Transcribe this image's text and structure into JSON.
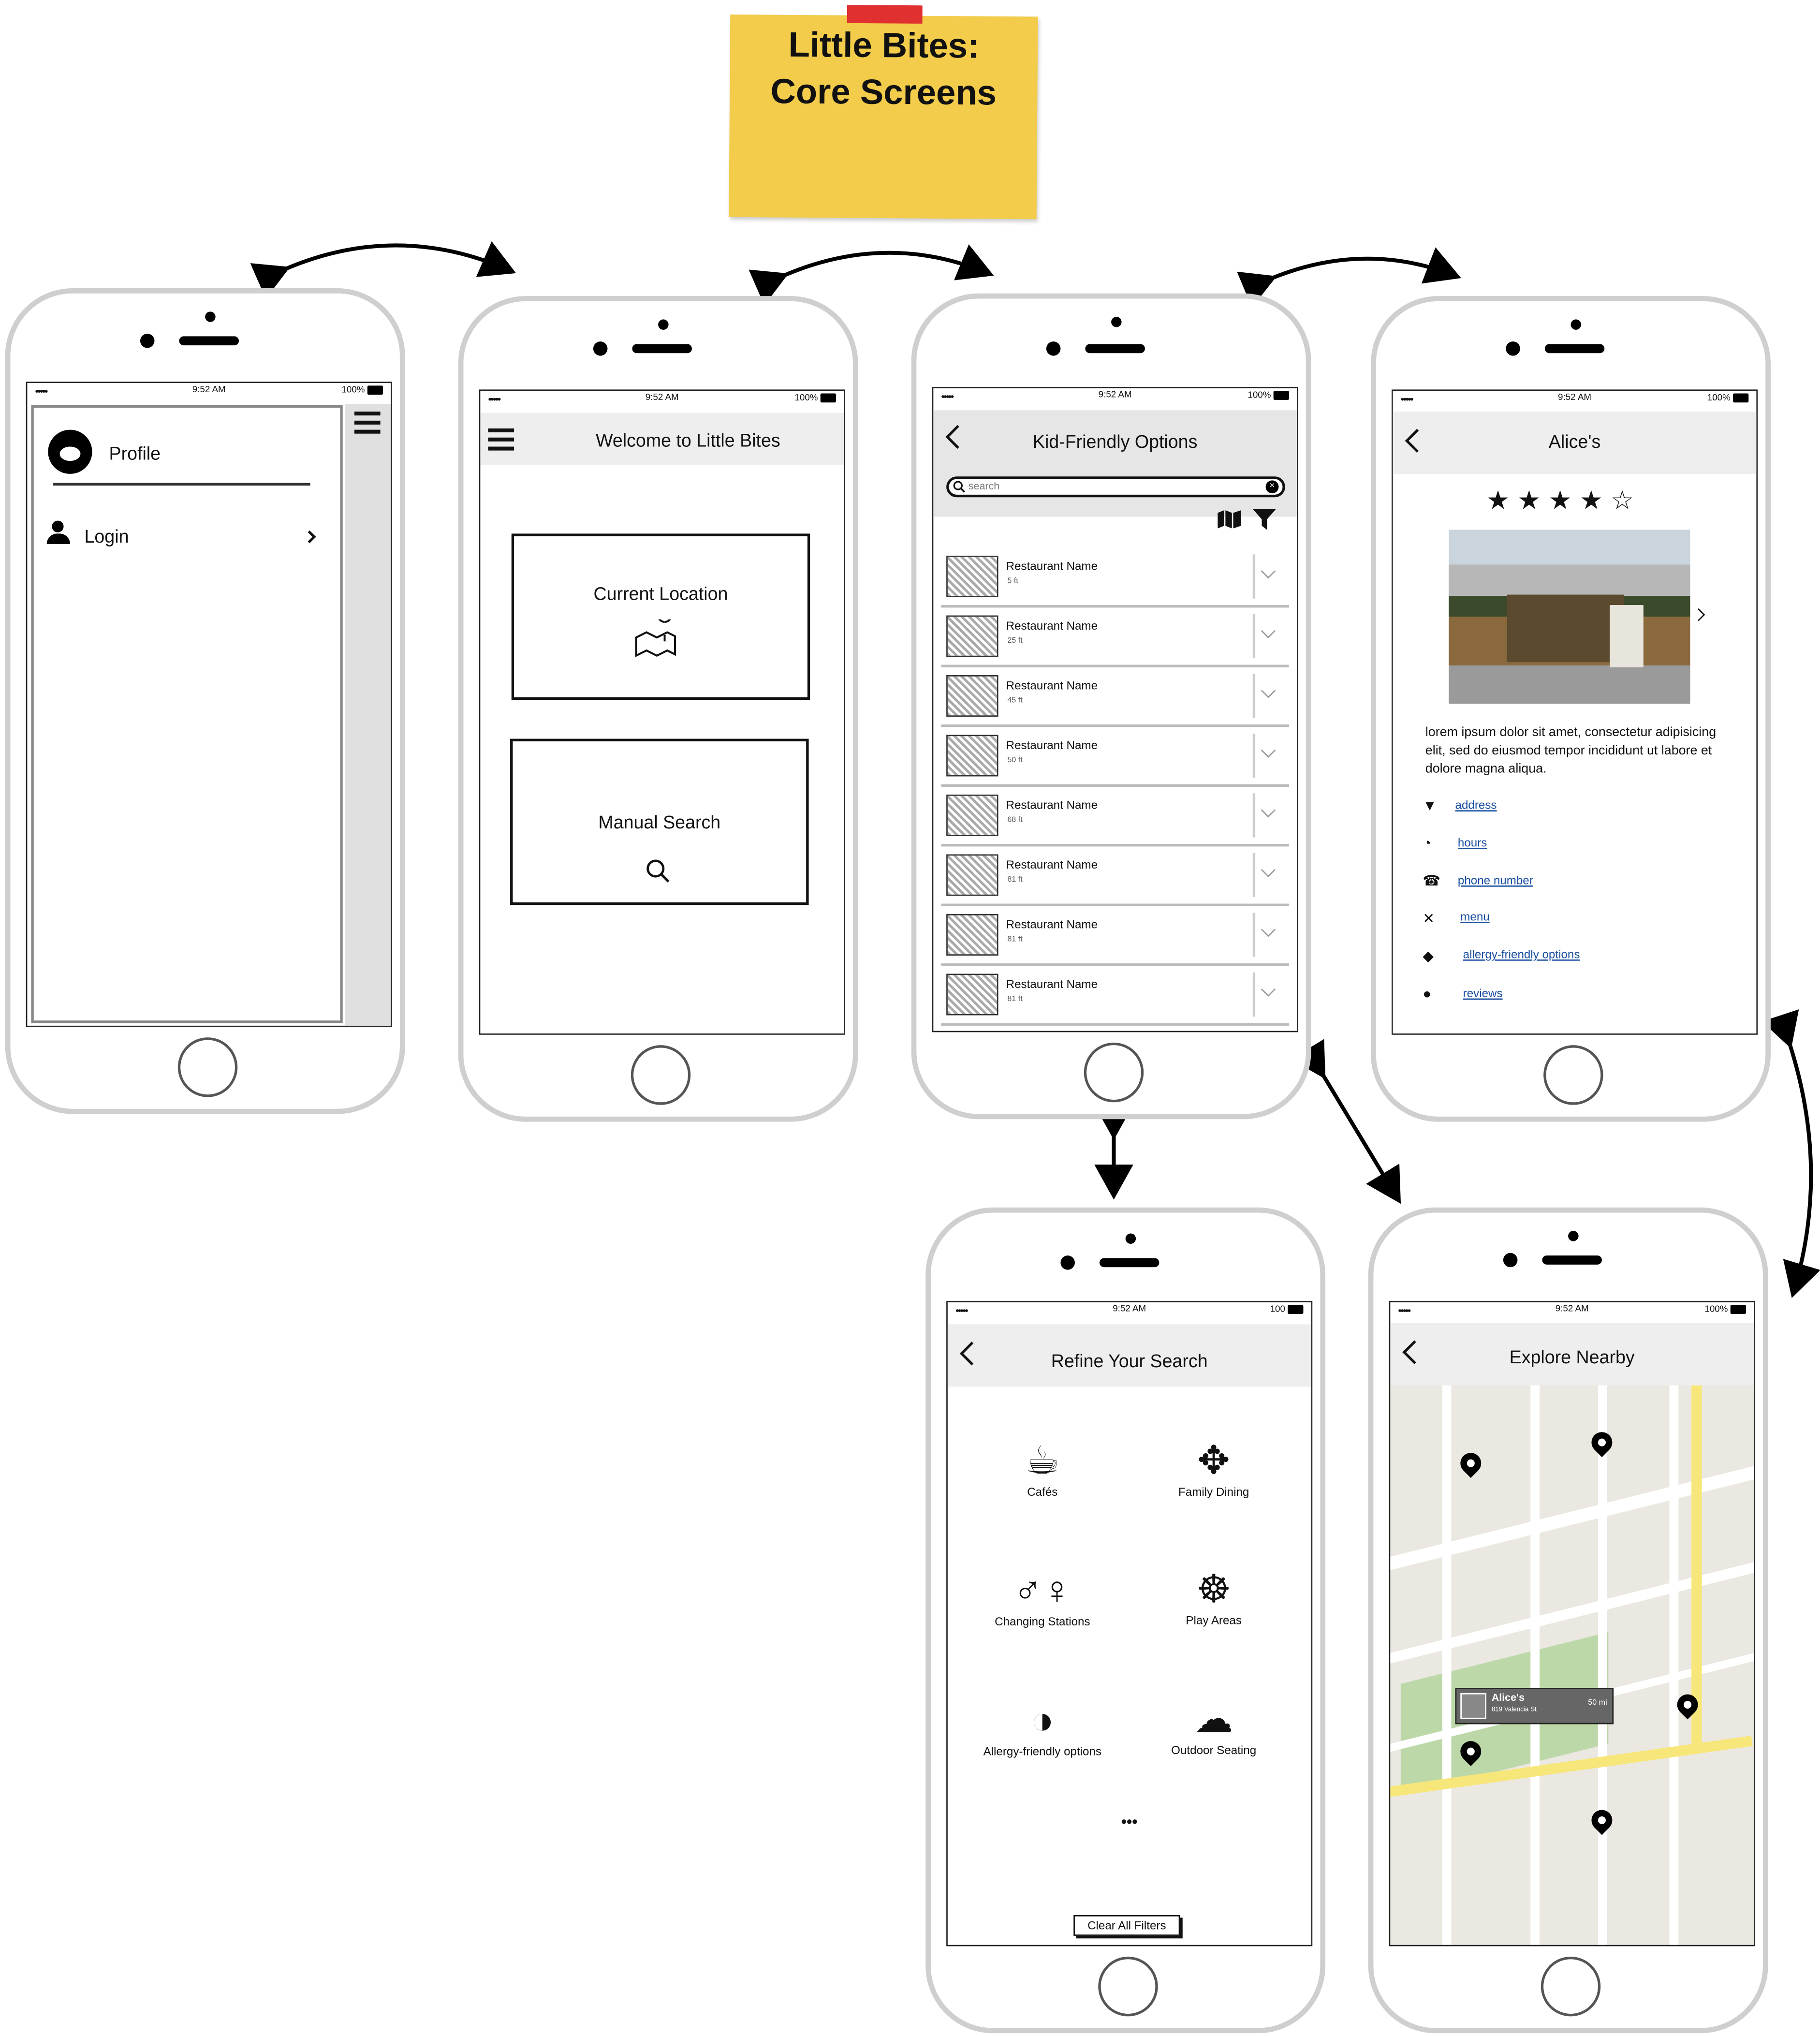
{
  "note": {
    "line1": "Little Bites:",
    "line2": "Core Screens"
  },
  "status": {
    "time": "9:52 AM",
    "battery": "100%",
    "battery_short": "100",
    "signal": "•••••"
  },
  "profile_screen": {
    "profile": "Profile",
    "login": "Login"
  },
  "welcome_screen": {
    "title": "Welcome to Little Bites",
    "current_location": "Current Location",
    "manual_search": "Manual Search"
  },
  "list_screen": {
    "title": "Kid-Friendly Options",
    "search_placeholder": "search",
    "items": [
      {
        "name": "Restaurant Name",
        "distance": "5 ft"
      },
      {
        "name": "Restaurant Name",
        "distance": "25 ft"
      },
      {
        "name": "Restaurant Name",
        "distance": "45 ft"
      },
      {
        "name": "Restaurant Name",
        "distance": "50 ft"
      },
      {
        "name": "Restaurant Name",
        "distance": "68 ft"
      },
      {
        "name": "Restaurant Name",
        "distance": "81 ft"
      },
      {
        "name": "Restaurant Name",
        "distance": "81 ft"
      },
      {
        "name": "Restaurant Name",
        "distance": "81 ft"
      }
    ]
  },
  "detail_screen": {
    "title": "Alice's",
    "rating": 4,
    "rating_max": 5,
    "description": "lorem ipsum dolor sit amet, consectetur adipisicing elit, sed do eiusmod tempor incididunt ut labore et dolore magna aliqua.",
    "links": {
      "address": "address",
      "hours": "hours",
      "phone": "phone number",
      "menu": "menu",
      "allergy": "allergy-friendly options",
      "reviews": "reviews"
    }
  },
  "refine_screen": {
    "title": "Refine Your Search",
    "cafes": "Cafés",
    "family_dining": "Family Dining",
    "changing_stations": "Changing Stations",
    "play_areas": "Play Areas",
    "allergy_options": "Allergy-friendly options",
    "outdoor_seating": "Outdoor Seating",
    "more": "•••",
    "clear": "Clear All Filters"
  },
  "map_screen": {
    "title": "Explore Nearby",
    "callout_name": "Alice's",
    "callout_address": "819 Valencia St",
    "callout_distance": "50 mi"
  },
  "colors": {
    "note": "#f2cc4a",
    "tape": "#e03030",
    "phone_frame": "#cfcfcf",
    "header_gray": "#eeeeee",
    "link_blue": "#1a4fa0",
    "map_green": "#bcd8a8",
    "map_yellow": "#f7e77a"
  }
}
